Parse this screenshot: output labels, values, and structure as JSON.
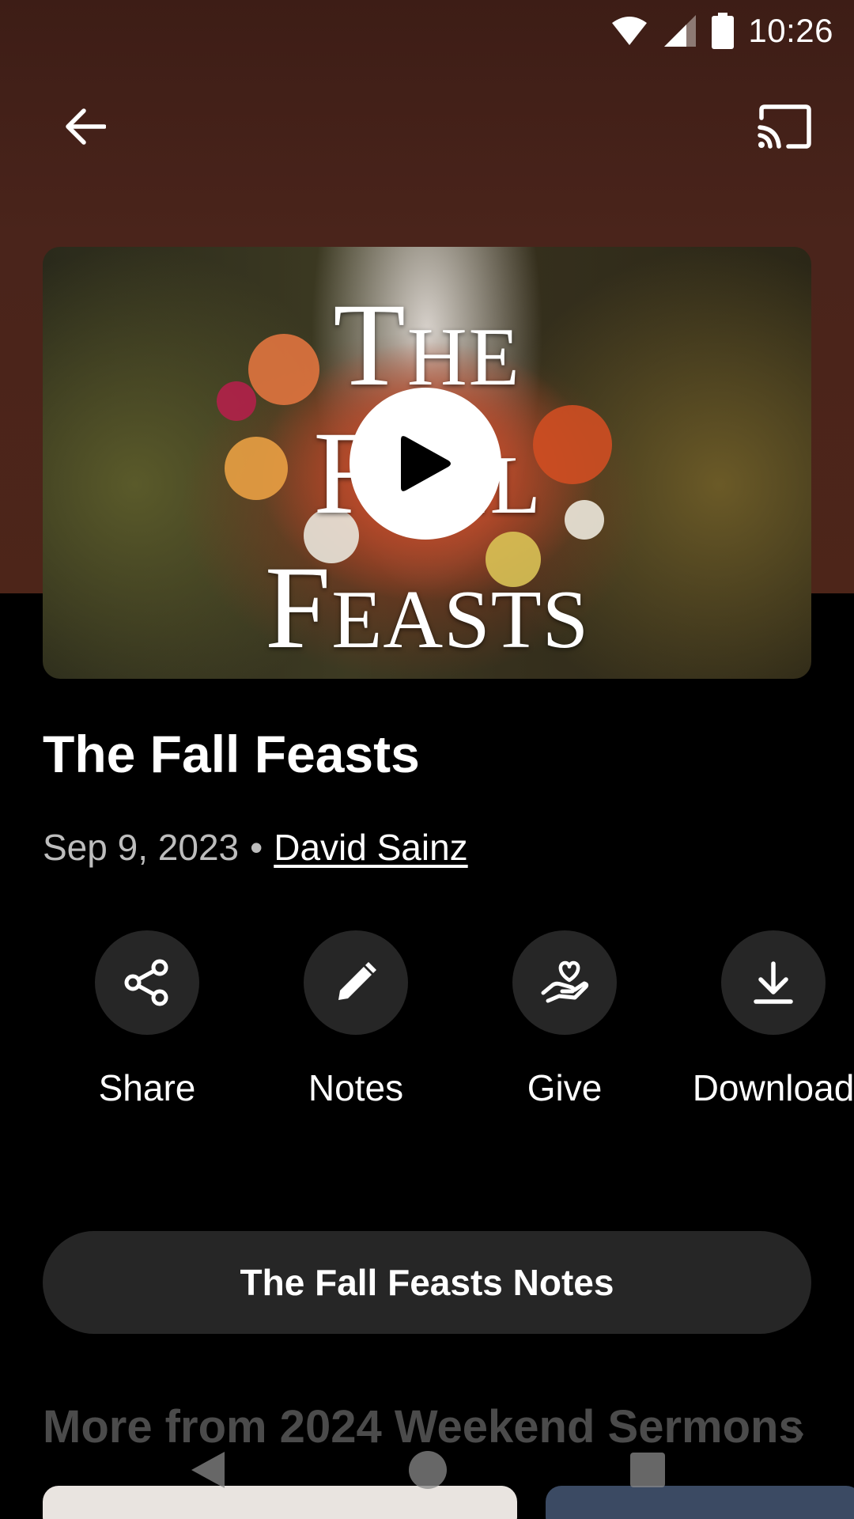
{
  "status_bar": {
    "time": "10:26",
    "icons": [
      "wifi-icon",
      "cellular-signal-icon",
      "battery-icon"
    ]
  },
  "top_bar": {
    "back_icon": "arrow-left-icon",
    "cast_icon": "cast-icon"
  },
  "artwork": {
    "title_line1": "The",
    "title_line2": "Fall",
    "title_line3": "Feasts",
    "play_icon": "play-icon"
  },
  "sermon": {
    "title": "The Fall Feasts",
    "date": "Sep 9, 2023",
    "separator": "•",
    "author": "David Sainz"
  },
  "actions": [
    {
      "label": "Share",
      "icon": "share-icon"
    },
    {
      "label": "Notes",
      "icon": "pencil-icon"
    },
    {
      "label": "Give",
      "icon": "give-heart-hand-icon"
    },
    {
      "label": "Download",
      "icon": "download-icon"
    }
  ],
  "notes_button": {
    "label": "The Fall Feasts Notes"
  },
  "more": {
    "title": "More from 2024 Weekend Sermons",
    "chevron": "›"
  },
  "nav_bar": {
    "icons": [
      "nav-back-icon",
      "nav-home-icon",
      "nav-recents-icon"
    ]
  },
  "colors": {
    "hero_background": "#4a241b",
    "page_background": "#000000",
    "button_background": "#262626",
    "muted_text": "#bdbdbd",
    "faded_heading": "#4b4b4b"
  }
}
